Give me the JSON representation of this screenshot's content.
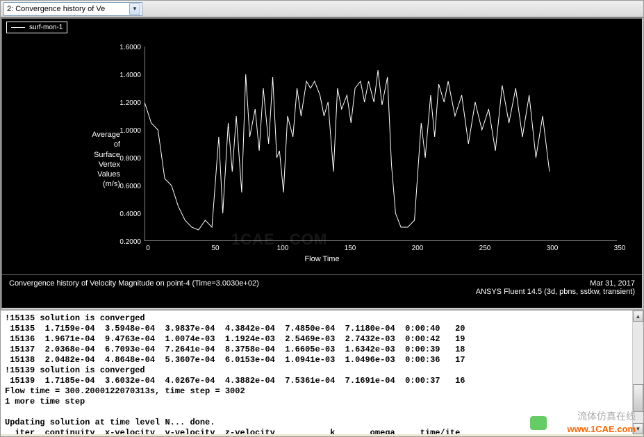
{
  "toolbar": {
    "dropdown_label": "2: Convergence history of Ve"
  },
  "legend": {
    "series_name": "surf-mon-1"
  },
  "axes": {
    "ylabel_lines": "Average\nof\nSurface\nVertex\nValues\n(m/s)",
    "xlabel": "Flow Time",
    "yticks": [
      "1.6000",
      "1.4000",
      "1.2000",
      "1.0000",
      "0.8000",
      "0.6000",
      "0.4000",
      "0.2000"
    ],
    "xticks": [
      "0",
      "50",
      "100",
      "150",
      "200",
      "250",
      "300",
      "350"
    ]
  },
  "caption": {
    "left": "Convergence history of Velocity Magnitude on point-4  (Time=3.0030e+02)",
    "right_date": "Mar 31, 2017",
    "right_solver": "ANSYS Fluent 14.5 (3d, pbns, sstkw, transient)"
  },
  "watermark_plot": "1CAE . COM",
  "watermark_right1": "流体仿真在线",
  "watermark_right2": "www.1CAE.com",
  "console_text": "!15135 solution is converged\n 15135  1.7159e-04  3.5948e-04  3.9837e-04  4.3842e-04  7.4850e-04  7.1180e-04  0:00:40   20\n 15136  1.9671e-04  9.4763e-04  1.0074e-03  1.1924e-03  2.5469e-03  2.7432e-03  0:00:42   19\n 15137  2.0368e-04  6.7093e-04  7.2641e-04  8.3758e-04  1.6605e-03  1.6342e-03  0:00:39   18\n 15138  2.0482e-04  4.8648e-04  5.3607e-04  6.0153e-04  1.0941e-03  1.0496e-03  0:00:36   17\n!15139 solution is converged\n 15139  1.7185e-04  3.6032e-04  4.0267e-04  4.3882e-04  7.5361e-04  7.1691e-04  0:00:37   16\nFlow time = 300.2000122070313s, time step = 3002\n1 more time step\n\nUpdating solution at time level N... done.\n  iter  continuity  x-velocity  y-velocity  z-velocity           k       omega     time/ite",
  "chart_data": {
    "type": "line",
    "title": "Convergence history of Velocity Magnitude on point-4",
    "xlabel": "Flow Time",
    "ylabel": "Average of Surface Vertex Values (m/s)",
    "xlim": [
      0,
      350
    ],
    "ylim": [
      0.2,
      1.6
    ],
    "series": [
      {
        "name": "surf-mon-1",
        "x": [
          0,
          5,
          10,
          15,
          20,
          25,
          30,
          35,
          40,
          45,
          50,
          55,
          58,
          62,
          65,
          68,
          72,
          75,
          78,
          82,
          85,
          88,
          92,
          95,
          98,
          100,
          103,
          106,
          110,
          113,
          116,
          120,
          123,
          126,
          130,
          133,
          136,
          140,
          143,
          146,
          150,
          153,
          156,
          160,
          163,
          166,
          170,
          173,
          176,
          180,
          183,
          186,
          190,
          195,
          200,
          205,
          208,
          212,
          215,
          218,
          222,
          225,
          230,
          235,
          240,
          245,
          250,
          255,
          260,
          265,
          270,
          275,
          280,
          285,
          290,
          295,
          300
        ],
        "y": [
          1.2,
          1.05,
          1.0,
          0.65,
          0.6,
          0.45,
          0.35,
          0.3,
          0.28,
          0.35,
          0.3,
          0.95,
          0.4,
          1.05,
          0.7,
          1.1,
          0.55,
          1.4,
          0.95,
          1.15,
          0.85,
          1.3,
          0.9,
          1.38,
          0.8,
          0.85,
          0.55,
          1.1,
          0.95,
          1.3,
          1.1,
          1.35,
          1.3,
          1.35,
          1.25,
          1.1,
          1.2,
          0.7,
          1.3,
          1.15,
          1.25,
          1.05,
          1.3,
          1.35,
          1.2,
          1.35,
          1.2,
          1.43,
          1.18,
          1.38,
          0.75,
          0.4,
          0.3,
          0.3,
          0.35,
          1.05,
          0.8,
          1.25,
          0.95,
          1.33,
          1.2,
          1.35,
          1.1,
          1.25,
          0.9,
          1.2,
          1.0,
          1.15,
          0.85,
          1.32,
          1.05,
          1.3,
          0.95,
          1.25,
          0.8,
          1.1,
          0.7
        ]
      }
    ]
  }
}
